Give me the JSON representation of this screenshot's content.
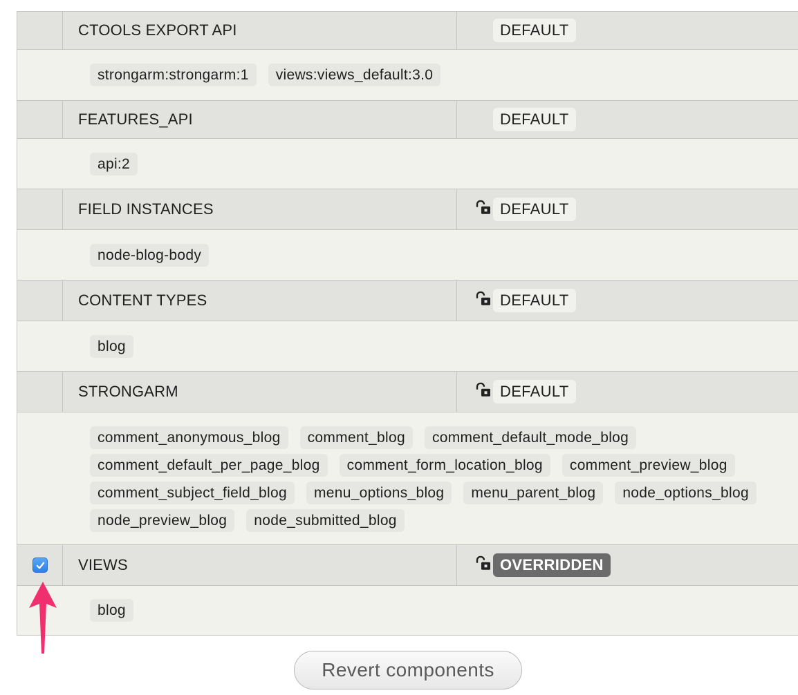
{
  "components": [
    {
      "name": "CTOOLS EXPORT API",
      "state": "DEFAULT",
      "overridden": false,
      "locked": false,
      "checked": false,
      "items": [
        "strongarm:strongarm:1",
        "views:views_default:3.0"
      ]
    },
    {
      "name": "FEATURES_API",
      "state": "DEFAULT",
      "overridden": false,
      "locked": false,
      "checked": false,
      "items": [
        "api:2"
      ]
    },
    {
      "name": "FIELD INSTANCES",
      "state": "DEFAULT",
      "overridden": false,
      "locked": true,
      "checked": false,
      "items": [
        "node-blog-body"
      ]
    },
    {
      "name": "CONTENT TYPES",
      "state": "DEFAULT",
      "overridden": false,
      "locked": true,
      "checked": false,
      "items": [
        "blog"
      ]
    },
    {
      "name": "STRONGARM",
      "state": "DEFAULT",
      "overridden": false,
      "locked": true,
      "checked": false,
      "items": [
        "comment_anonymous_blog",
        "comment_blog",
        "comment_default_mode_blog",
        "comment_default_per_page_blog",
        "comment_form_location_blog",
        "comment_preview_blog",
        "comment_subject_field_blog",
        "menu_options_blog",
        "menu_parent_blog",
        "node_options_blog",
        "node_preview_blog",
        "node_submitted_blog"
      ]
    },
    {
      "name": "VIEWS",
      "state": "OVERRIDDEN",
      "overridden": true,
      "locked": true,
      "checked": true,
      "items": [
        "blog"
      ]
    }
  ],
  "revert_button_label": "Revert components",
  "icons": {
    "lock": "unlocked-padlock-icon",
    "checkbox": "checkmark-icon",
    "annotation": "pink-arrow-icon"
  },
  "colors": {
    "header_bg": "#e2e2de",
    "body_bg": "#f2f2ed",
    "overridden_badge": "#6b6b6b",
    "checkbox_blue": "#2b7fe8",
    "arrow_pink": "#f0306e"
  }
}
